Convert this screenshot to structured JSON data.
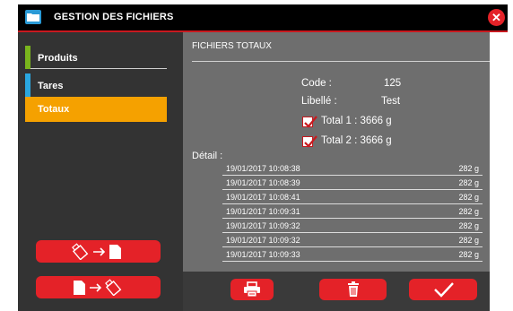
{
  "window": {
    "title": "GESTION DES FICHIERS"
  },
  "sidebar": {
    "items": [
      {
        "label": "Produits",
        "accent": "#7ab51d"
      },
      {
        "label": "Tares",
        "accent": "#2aa7e0"
      },
      {
        "label": "Totaux",
        "accent": "#f5a100",
        "selected": true
      }
    ]
  },
  "panel": {
    "heading": "FICHIERS TOTAUX",
    "code_label": "Code :",
    "code_value": "125",
    "libelle_label": "Libellé :",
    "libelle_value": "Test",
    "total1": "Total 1 : 3666 g",
    "total2": "Total 2 : 3666 g",
    "total1_checked": true,
    "total2_checked": true,
    "detail_label": "Détail :",
    "rows": [
      {
        "date": "19/01/2017 10:08:38",
        "weight": "282 g"
      },
      {
        "date": "19/01/2017 10:08:39",
        "weight": "282 g"
      },
      {
        "date": "19/01/2017 10:08:41",
        "weight": "282 g"
      },
      {
        "date": "19/01/2017 10:09:31",
        "weight": "282 g"
      },
      {
        "date": "19/01/2017 10:09:32",
        "weight": "282 g"
      },
      {
        "date": "19/01/2017 10:09:32",
        "weight": "282 g"
      },
      {
        "date": "19/01/2017 10:09:33",
        "weight": "282 g"
      }
    ]
  },
  "icons": {
    "title": "folder-icon",
    "close": "close-icon",
    "import": "usb-to-file-icon",
    "export": "file-to-usb-icon",
    "print": "printer-icon",
    "delete": "trash-icon",
    "ok": "checkmark-icon"
  },
  "colors": {
    "accent_red": "#e42228",
    "selected_orange": "#f5a100",
    "panel_gray": "#6e6e6e",
    "sidebar_dark": "#333333"
  }
}
